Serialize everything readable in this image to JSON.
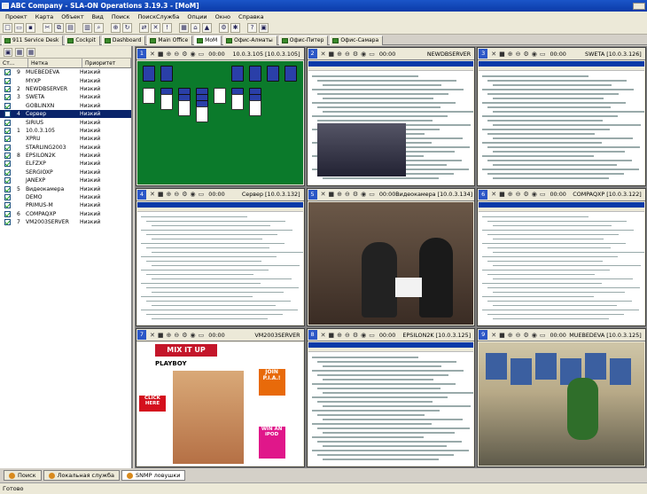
{
  "window": {
    "title": "ABC Company - SLA-ON Operations 3.19.3 - [MoM]"
  },
  "menu": [
    "Проект",
    "Карта",
    "Объект",
    "Вид",
    "Поиск",
    "ПоискСлужба",
    "Опции",
    "Окно",
    "Справка"
  ],
  "tabs": [
    {
      "label": "911 Service Desk",
      "active": false
    },
    {
      "label": "Cockpit",
      "active": false
    },
    {
      "label": "Dashboard",
      "active": false
    },
    {
      "label": "Main Office",
      "active": false
    },
    {
      "label": "MoM",
      "active": true
    },
    {
      "label": "Офис-Алматы",
      "active": false
    },
    {
      "label": "Офис-Питер",
      "active": false
    },
    {
      "label": "Офис-Самара",
      "active": false
    }
  ],
  "left_panel": {
    "columns": [
      "Ст...",
      "Нетка",
      "Приоритет"
    ],
    "rows": [
      {
        "num": "9",
        "name": "MUEBEDEVA",
        "priority": "Низкий",
        "checked": true,
        "selected": false
      },
      {
        "num": "",
        "name": "MYXP",
        "priority": "Низкий",
        "checked": true,
        "selected": false
      },
      {
        "num": "2",
        "name": "NEWDBSERVER",
        "priority": "Низкий",
        "checked": true,
        "selected": false
      },
      {
        "num": "3",
        "name": "SWETA",
        "priority": "Низкий",
        "checked": true,
        "selected": false
      },
      {
        "num": "",
        "name": "GOBLINXN",
        "priority": "Низкий",
        "checked": true,
        "selected": false
      },
      {
        "num": "4",
        "name": "Сервер",
        "priority": "Низкий",
        "checked": false,
        "selected": true
      },
      {
        "num": "",
        "name": "SIRIUS",
        "priority": "Низкий",
        "checked": true,
        "selected": false
      },
      {
        "num": "1",
        "name": "10.0.3.105",
        "priority": "Низкий",
        "checked": true,
        "selected": false
      },
      {
        "num": "",
        "name": "XPRU",
        "priority": "Низкий",
        "checked": true,
        "selected": false
      },
      {
        "num": "",
        "name": "STARLING2003",
        "priority": "Низкий",
        "checked": true,
        "selected": false
      },
      {
        "num": "8",
        "name": "EPSILON2K",
        "priority": "Низкий",
        "checked": true,
        "selected": false
      },
      {
        "num": "",
        "name": "ELFZXP",
        "priority": "Низкий",
        "checked": true,
        "selected": false
      },
      {
        "num": "",
        "name": "SERGIOXP",
        "priority": "Низкий",
        "checked": true,
        "selected": false
      },
      {
        "num": "",
        "name": "JANEXP",
        "priority": "Низкий",
        "checked": true,
        "selected": false
      },
      {
        "num": "5",
        "name": "Видеокамера",
        "priority": "Низкий",
        "checked": true,
        "selected": false
      },
      {
        "num": "",
        "name": "DEMO",
        "priority": "Низкий",
        "checked": true,
        "selected": false
      },
      {
        "num": "",
        "name": "PRIMUS-M",
        "priority": "Низкий",
        "checked": true,
        "selected": false
      },
      {
        "num": "6",
        "name": "COMPAQXP",
        "priority": "Низкий",
        "checked": true,
        "selected": false
      },
      {
        "num": "7",
        "name": "VM2003SERVER",
        "priority": "Низкий",
        "checked": true,
        "selected": false
      }
    ]
  },
  "cells": [
    {
      "idx": "1",
      "time": "00:00",
      "title": "10.0.3.105 [10.0.3.105]",
      "kind": "solitaire"
    },
    {
      "idx": "2",
      "time": "00:00",
      "title": "NEWDBSERVER",
      "kind": "browser"
    },
    {
      "idx": "3",
      "time": "00:00",
      "title": "SWETA [10.0.3.126]",
      "kind": "sheet"
    },
    {
      "idx": "4",
      "time": "00:00",
      "title": "Сервер [10.0.3.132]",
      "kind": "sheet"
    },
    {
      "idx": "5",
      "time": "00:00",
      "title": "Видеокамера [10.0.3.134]",
      "kind": "office"
    },
    {
      "idx": "6",
      "time": "00:00",
      "title": "COMPAQXP [10.0.3.122]",
      "kind": "sheet"
    },
    {
      "idx": "7",
      "time": "00:00",
      "title": "VM2003SERVER",
      "kind": "magazine"
    },
    {
      "idx": "8",
      "time": "00:00",
      "title": "EPSILON2K [10.0.3.125]",
      "kind": "sheet"
    },
    {
      "idx": "9",
      "time": "00:00",
      "title": "MUEBEDEVA [10.0.3.125]",
      "kind": "officeroom"
    }
  ],
  "magazine_text": {
    "headline": "MIX IT UP",
    "brand": "PLAYBOY",
    "promo": "JOIN P.I.A.!",
    "click": "CLICK HERE",
    "win": "WIN AN iPOD"
  },
  "bottom_tabs": [
    {
      "label": "Поиск",
      "active": false
    },
    {
      "label": "Локальная служба",
      "active": false
    },
    {
      "label": "SNMP ловушки",
      "active": true
    }
  ],
  "status": {
    "text": "Готово"
  }
}
